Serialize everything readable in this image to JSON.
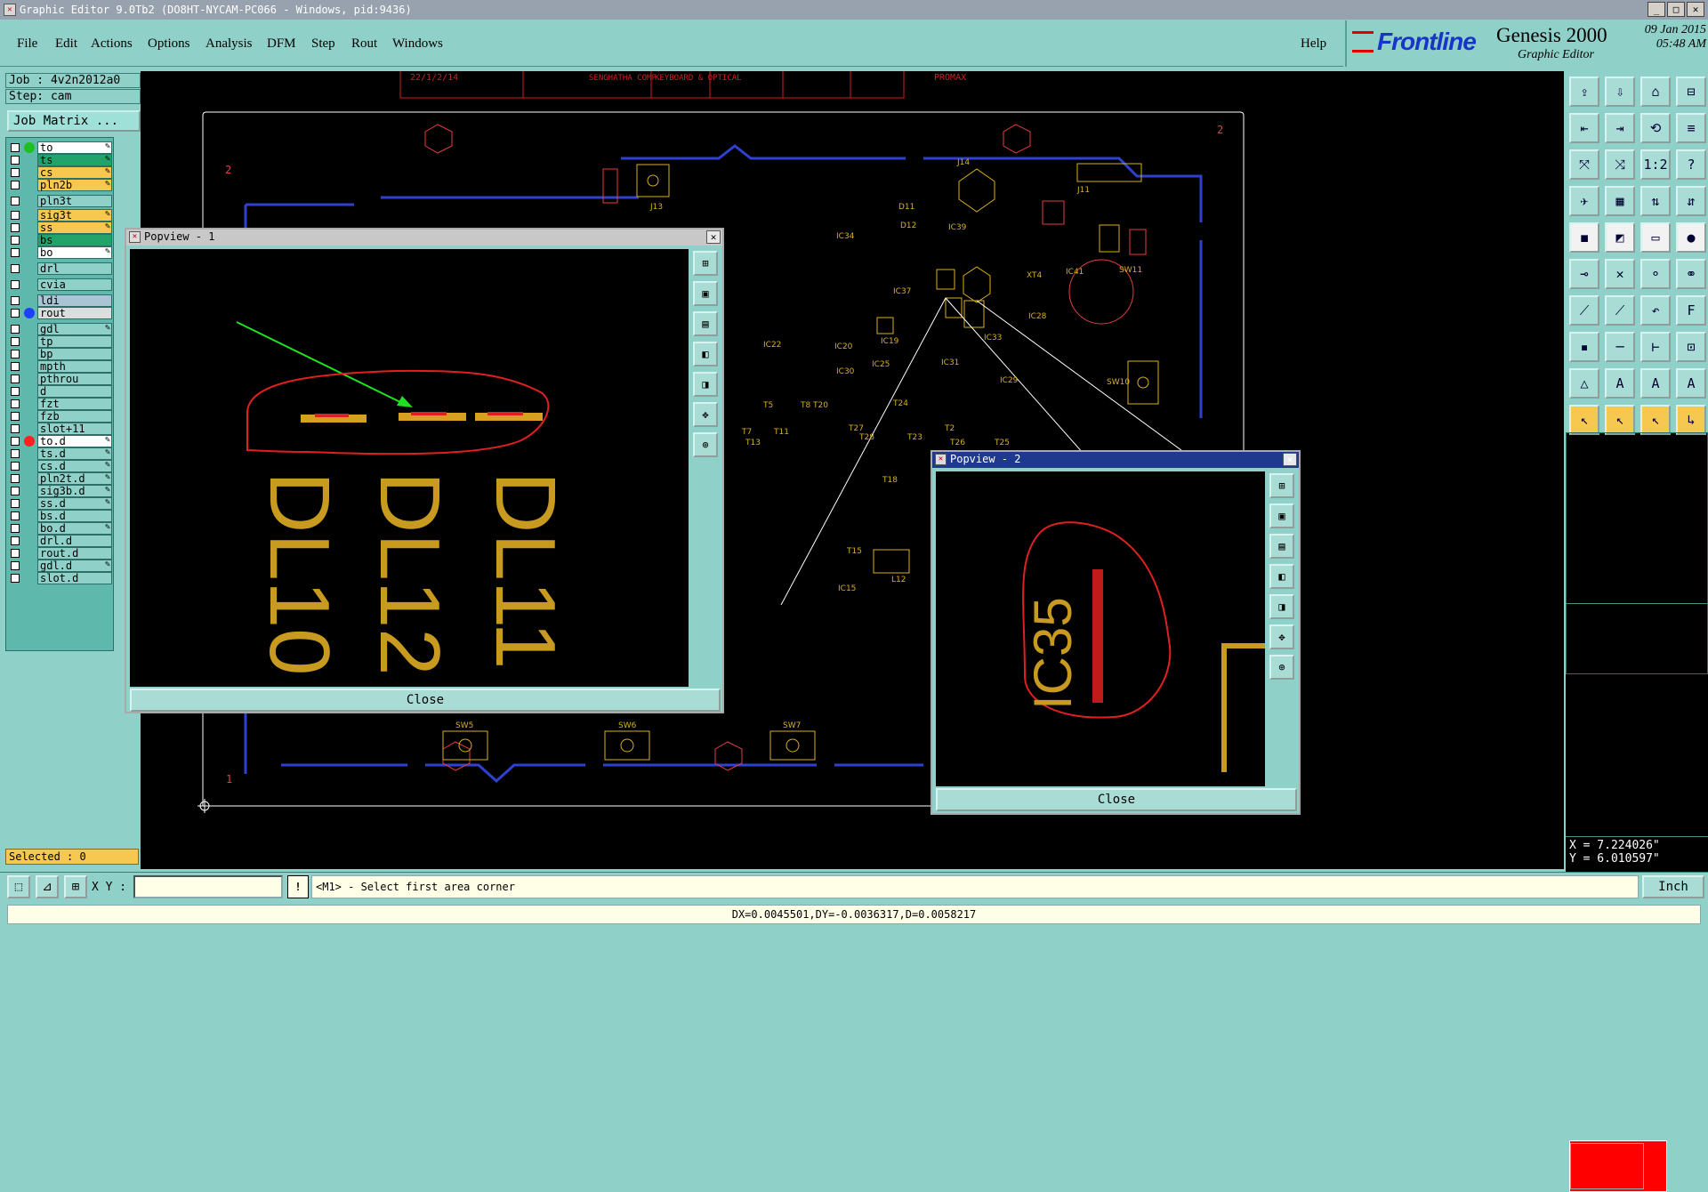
{
  "window_title": "Graphic Editor 9.0Tb2 (DO8HT-NYCAM-PC066 - Windows, pid:9436)",
  "menu": [
    "File",
    "Edit",
    "Actions",
    "Options",
    "Analysis",
    "DFM",
    "Step",
    "Rout",
    "Windows"
  ],
  "help_label": "Help",
  "brand": {
    "logo": "Frontline",
    "product": "Genesis 2000",
    "subtitle": "Graphic Editor",
    "date": "09 Jan 2015",
    "time": "05:48 AM"
  },
  "job_label": "Job : 4v2n2012a0",
  "step_label": "Step: cam",
  "job_matrix_label": "Job Matrix ...",
  "layers": [
    {
      "name": "to",
      "bg": "#ffffff",
      "dot": "#1fbf1f",
      "pen": true
    },
    {
      "name": "ts",
      "bg": "#22a36a",
      "dot": "",
      "pen": true
    },
    {
      "name": "cs",
      "bg": "#f7c850",
      "dot": "",
      "pen": true
    },
    {
      "name": "pln2b",
      "bg": "#f7c850",
      "dot": "",
      "pen": true
    },
    {
      "name": "pln3t",
      "bg": "#8fd1c9",
      "dot": "",
      "pen": false
    },
    {
      "name": "sig3t",
      "bg": "#f7c850",
      "dot": "",
      "pen": true
    },
    {
      "name": "ss",
      "bg": "#f7c850",
      "dot": "",
      "pen": true
    },
    {
      "name": "bs",
      "bg": "#22a36a",
      "dot": "",
      "pen": false
    },
    {
      "name": "bo",
      "bg": "#ffffff",
      "dot": "",
      "pen": true
    },
    {
      "name": "drl",
      "bg": "#8fd1c9",
      "dot": "",
      "pen": false
    },
    {
      "name": "cvia",
      "bg": "#8fd1c9",
      "dot": "",
      "pen": false
    },
    {
      "name": "ldi",
      "bg": "#a9c4d4",
      "dot": "",
      "pen": false
    },
    {
      "name": "rout",
      "bg": "#dddddd",
      "dot": "#1f3fff",
      "pen": false
    },
    {
      "name": "gdl",
      "bg": "#8fd1c9",
      "dot": "",
      "pen": true
    },
    {
      "name": "tp",
      "bg": "#8fd1c9",
      "dot": "",
      "pen": false
    },
    {
      "name": "bp",
      "bg": "#8fd1c9",
      "dot": "",
      "pen": false
    },
    {
      "name": "mpth",
      "bg": "#8fd1c9",
      "dot": "",
      "pen": false
    },
    {
      "name": "pthrou",
      "bg": "#8fd1c9",
      "dot": "",
      "pen": false
    },
    {
      "name": "d",
      "bg": "#8fd1c9",
      "dot": "",
      "pen": false
    },
    {
      "name": "fzt",
      "bg": "#8fd1c9",
      "dot": "",
      "pen": false
    },
    {
      "name": "fzb",
      "bg": "#8fd1c9",
      "dot": "",
      "pen": false
    },
    {
      "name": "slot+11",
      "bg": "#8fd1c9",
      "dot": "",
      "pen": false
    },
    {
      "name": "to.d",
      "bg": "#ffffff",
      "dot": "#ff2020",
      "pen": true
    },
    {
      "name": "ts.d",
      "bg": "#8fd1c9",
      "dot": "",
      "pen": true
    },
    {
      "name": "cs.d",
      "bg": "#8fd1c9",
      "dot": "",
      "pen": true
    },
    {
      "name": "pln2t.d",
      "bg": "#8fd1c9",
      "dot": "",
      "pen": true
    },
    {
      "name": "sig3b.d",
      "bg": "#8fd1c9",
      "dot": "",
      "pen": true
    },
    {
      "name": "ss.d",
      "bg": "#8fd1c9",
      "dot": "",
      "pen": true
    },
    {
      "name": "bs.d",
      "bg": "#8fd1c9",
      "dot": "",
      "pen": false
    },
    {
      "name": "bo.d",
      "bg": "#8fd1c9",
      "dot": "",
      "pen": true
    },
    {
      "name": "drl.d",
      "bg": "#8fd1c9",
      "dot": "",
      "pen": false
    },
    {
      "name": "rout.d",
      "bg": "#8fd1c9",
      "dot": "",
      "pen": false
    },
    {
      "name": "gdl.d",
      "bg": "#8fd1c9",
      "dot": "",
      "pen": true
    },
    {
      "name": "slot.d",
      "bg": "#8fd1c9",
      "dot": "",
      "pen": false
    }
  ],
  "selected_label": "Selected : 0",
  "popview1": {
    "title": "Popview - 1",
    "close": "Close",
    "texts": [
      "DL10",
      "DL12",
      "DL11"
    ]
  },
  "popview2": {
    "title": "Popview - 2",
    "close": "Close",
    "text": "IC35"
  },
  "board_labels": [
    "J13",
    "J14",
    "J11",
    "SW11",
    "IC41",
    "XT4",
    "IC34",
    "IC39",
    "IC37",
    "IC22",
    "IC19",
    "IC30",
    "IC25",
    "IC33",
    "IC31",
    "IC28",
    "IC29",
    "SW10",
    "T5",
    "T8",
    "T20",
    "T24",
    "T11",
    "T27",
    "T28",
    "T23",
    "T2",
    "T26",
    "T25",
    "T13",
    "T7",
    "T18",
    "T15",
    "L12",
    "IC15",
    "SW5",
    "SW6",
    "SW7",
    "D11",
    "D12",
    "IC20"
  ],
  "title_block": [
    "22/1/2/14",
    "SENGHATHA COMP.",
    "KEYBOARD & OPTICAL",
    "PROMAX"
  ],
  "coords": {
    "x": "X = 7.224026\"",
    "y": "Y = 6.010597\""
  },
  "xy_label": "X Y :",
  "prompt": "<M1> - Select first area corner",
  "unit": "Inch",
  "status": "DX=0.0045501,DY=-0.0036317,D=0.0058217"
}
